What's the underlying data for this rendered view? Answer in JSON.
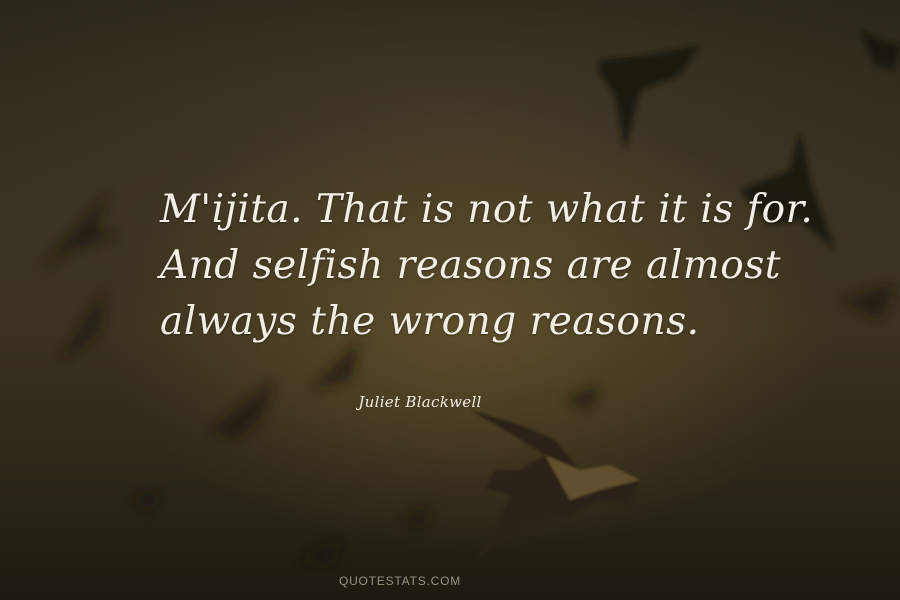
{
  "quote": {
    "lines": [
      "M'ijita. That is not what it is for.",
      "And selfish reasons are almost",
      "always the wrong reasons."
    ],
    "author": "Juliet Blackwell"
  },
  "footer": {
    "site": "QUOTESTATS.COM"
  },
  "colors": {
    "text": "#f3efe6",
    "background_dark": "#1e1b14",
    "glow": "#786234"
  }
}
